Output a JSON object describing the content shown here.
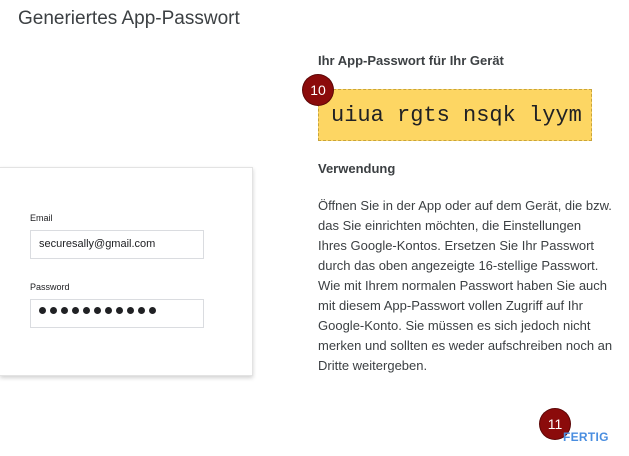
{
  "dialog": {
    "title": "Generiertes App-Passwort"
  },
  "login_illustration": {
    "email_label": "Email",
    "email_value": "securesally@gmail.com",
    "password_label": "Password",
    "password_mask_count": 11
  },
  "password_section": {
    "heading": "Ihr App-Passwort für Ihr Gerät",
    "password": "uiua rgts nsqk lyym",
    "box_color": "#fdd663"
  },
  "usage": {
    "heading": "Verwendung",
    "paragraph1": "Öffnen Sie in der App oder auf dem Gerät, die bzw. das Sie einrichten möchten, die Einstellungen Ihres Google-Kontos. Ersetzen Sie Ihr Passwort durch das oben angezeigte 16-stellige Passwort.",
    "paragraph2": "Wie mit Ihrem normalen Passwort haben Sie auch mit diesem App-Passwort vollen Zugriff auf Ihr Google-Konto. Sie müssen es sich jedoch nicht merken und sollten es weder aufschreiben noch an Dritte weitergeben."
  },
  "actions": {
    "done_label": "FERTIG",
    "accent_color": "#4a8ee0"
  },
  "step_badges": {
    "badge_password": "10",
    "badge_done": "11",
    "badge_color": "#8b0b0b"
  }
}
